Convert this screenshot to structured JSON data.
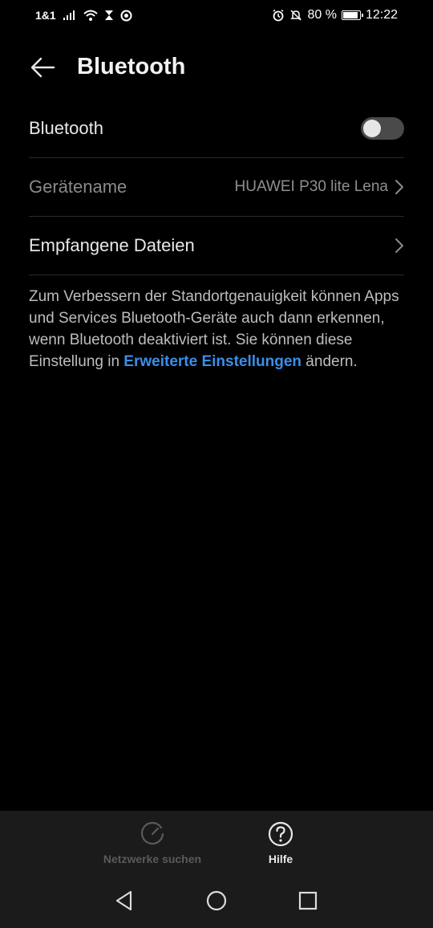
{
  "status_bar": {
    "carrier": "1&1",
    "battery": "80 %",
    "battery_level": 0.8,
    "time": "12:22",
    "icons": [
      "signal-icon",
      "wifi-icon",
      "hourglass-icon",
      "sync-icon",
      "alarm-icon",
      "mute-icon",
      "battery-icon"
    ]
  },
  "header": {
    "back_icon": "arrow-left-icon",
    "title": "Bluetooth"
  },
  "settings": {
    "bluetooth": {
      "label": "Bluetooth",
      "enabled": false
    },
    "device_name": {
      "label": "Gerätename",
      "value": "HUAWEI P30 lite Lena"
    },
    "received_files": {
      "label": "Empfangene Dateien"
    }
  },
  "info": {
    "text": "Zum Verbessern der Standortgenauigkeit können Apps und Services Bluetooth-Geräte auch dann erkennen, wenn Bluetooth deaktiviert ist. Sie können diese Einstellung in ",
    "link": "Erweiterte Einstellungen",
    "suffix": " ändern."
  },
  "actions": {
    "search_label": "Netzwerke suchen",
    "help_label": "Hilfe"
  },
  "colors": {
    "background": "#000000",
    "link": "#3a8fe8",
    "bottom_bar": "#1b1b1b"
  }
}
